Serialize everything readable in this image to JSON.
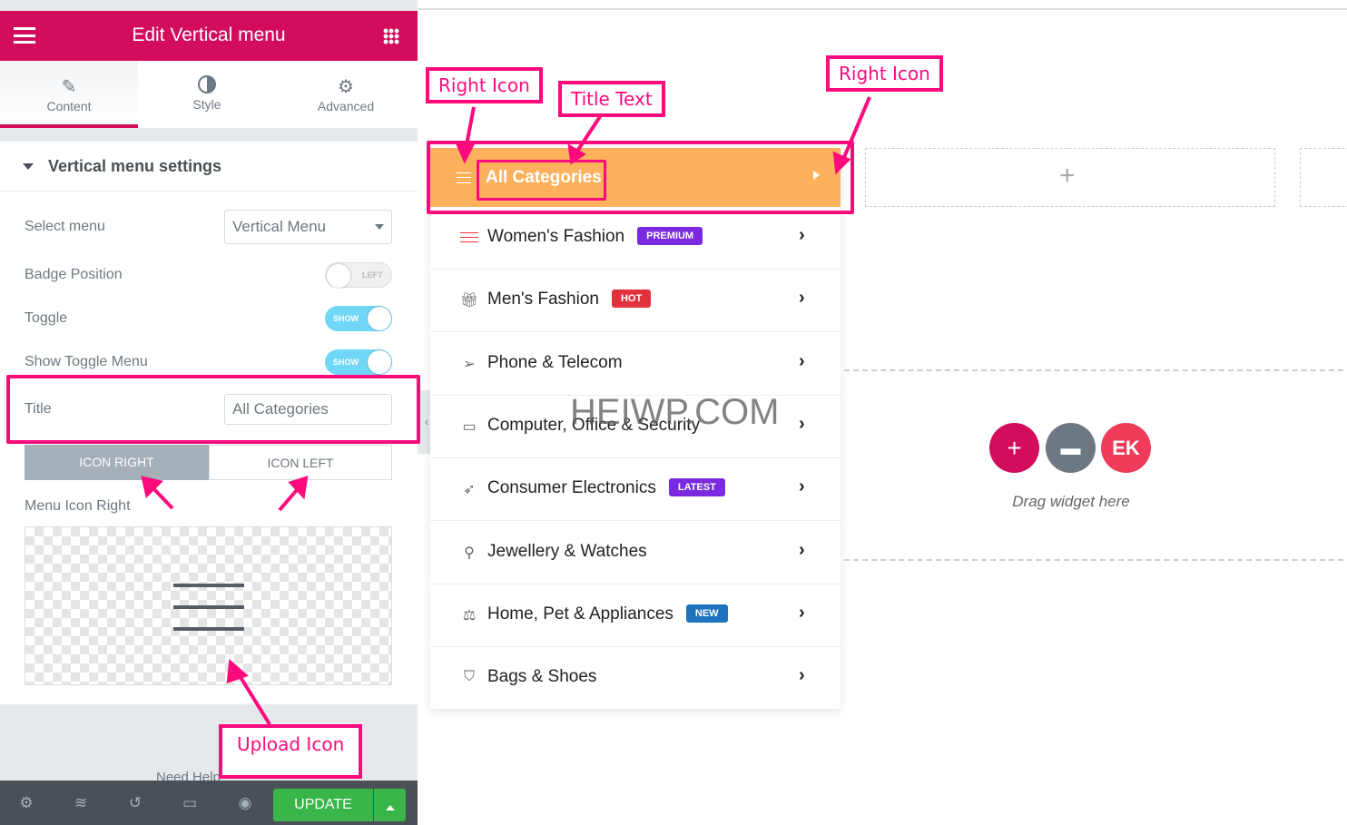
{
  "panel": {
    "title": "Edit Vertical menu",
    "tabs": [
      {
        "label": "Content",
        "icon": "pencil-icon"
      },
      {
        "label": "Style",
        "icon": "contrast-icon"
      },
      {
        "label": "Advanced",
        "icon": "gear-icon"
      }
    ],
    "section_title": "Vertical menu settings",
    "select_menu_label": "Select menu",
    "select_menu_value": "Vertical Menu",
    "badge_position_label": "Badge Position",
    "badge_position_value": "LEFT",
    "toggle_label": "Toggle",
    "toggle_value": "SHOW",
    "show_toggle_menu_label": "Show Toggle Menu",
    "show_toggle_menu_value": "SHOW",
    "title_label": "Title",
    "title_value": "All Categories",
    "icon_right": "ICON RIGHT",
    "icon_left": "ICON LEFT",
    "menu_icon_label": "Menu Icon Right",
    "need_help": "Need Help",
    "update": "UPDATE"
  },
  "menu": {
    "title": "All Categories",
    "items": [
      {
        "label": "Women's Fashion",
        "badge": "PREMIUM",
        "badge_color": "#7b2ae0",
        "icon": "lines-icon"
      },
      {
        "label": "Men's Fashion",
        "badge": "HOT",
        "badge_color": "#e0323c",
        "icon": "gift-icon"
      },
      {
        "label": "Phone & Telecom",
        "badge": "",
        "icon": "send-icon"
      },
      {
        "label": "Computer, Office & Security",
        "badge": "",
        "icon": "laptop-icon"
      },
      {
        "label": "Consumer Electronics",
        "badge": "LATEST",
        "badge_color": "#7b2ae0",
        "icon": "rocket-icon"
      },
      {
        "label": "Jewellery & Watches",
        "badge": "",
        "icon": "glasses-icon"
      },
      {
        "label": "Home, Pet & Appliances",
        "badge": "NEW",
        "badge_color": "#1e73be",
        "icon": "scale-icon"
      },
      {
        "label": "Bags & Shoes",
        "badge": "",
        "icon": "basket-icon"
      }
    ]
  },
  "canvas": {
    "drag_text": "Drag widget here"
  },
  "annotations": {
    "right_icon_1": "Right Icon",
    "title_text": "Title Text",
    "right_icon_2": "Right Icon",
    "upload_icon": "Upload Icon"
  },
  "watermark": "HEIWP.COM",
  "colors": {
    "brand": "#d30c5c",
    "menu_header": "#fdb15c",
    "annotation": "#ff0a7c",
    "update": "#39b54a"
  }
}
